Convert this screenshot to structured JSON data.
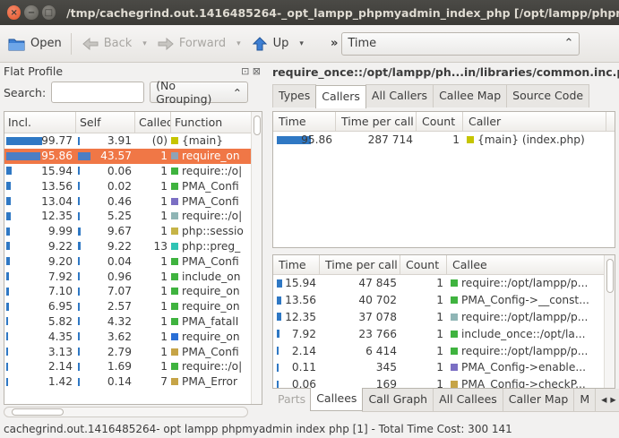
{
  "window": {
    "title": "/tmp/cachegrind.out.1416485264-_opt_lampp_phpmyadmin_index_php [/opt/lampp/phpmya",
    "close_glyph": "×",
    "min_glyph": "−",
    "max_glyph": "□"
  },
  "toolbar": {
    "open_label": "Open",
    "back_label": "Back",
    "forward_label": "Forward",
    "up_label": "Up",
    "overflow_label": "»",
    "event_type": "Time",
    "dropdown_glyph": "▾",
    "combo_glyph": "⌃"
  },
  "left": {
    "title": "Flat Profile",
    "header_icons": "⊡ ⊠",
    "search_label": "Search:",
    "search_value": "",
    "grouping_value": "(No Grouping)",
    "grouping_glyph": "⌃",
    "columns": [
      "Incl.",
      "Self",
      "Called",
      "Function"
    ],
    "rows": [
      {
        "incl": "99.77",
        "incl_pct": 99.77,
        "self": "3.91",
        "self_pct": 3.91,
        "called": "(0)",
        "func": "{main}",
        "color": "#c6c500",
        "selected": false
      },
      {
        "incl": "95.86",
        "incl_pct": 95.86,
        "self": "43.57",
        "self_pct": 43.57,
        "called": "1",
        "func": "require_on",
        "color": "#8fa3b5",
        "selected": true
      },
      {
        "incl": "15.94",
        "incl_pct": 15.94,
        "self": "0.06",
        "self_pct": 0.06,
        "called": "1",
        "func": "require::/o|",
        "color": "#3fb33f",
        "selected": false
      },
      {
        "incl": "13.56",
        "incl_pct": 13.56,
        "self": "0.02",
        "self_pct": 0.02,
        "called": "1",
        "func": "PMA_Confi",
        "color": "#3fb33f",
        "selected": false
      },
      {
        "incl": "13.04",
        "incl_pct": 13.04,
        "self": "0.46",
        "self_pct": 0.46,
        "called": "1",
        "func": "PMA_Confi",
        "color": "#7b6fc4",
        "selected": false
      },
      {
        "incl": "12.35",
        "incl_pct": 12.35,
        "self": "5.25",
        "self_pct": 5.25,
        "called": "1",
        "func": "require::/o|",
        "color": "#8fb5b5",
        "selected": false
      },
      {
        "incl": "9.99",
        "incl_pct": 9.99,
        "self": "9.67",
        "self_pct": 9.67,
        "called": "1",
        "func": "php::sessio",
        "color": "#c6b447",
        "selected": false
      },
      {
        "incl": "9.22",
        "incl_pct": 9.22,
        "self": "9.22",
        "self_pct": 9.22,
        "called": "13",
        "func": "php::preg_",
        "color": "#2fc4b4",
        "selected": false
      },
      {
        "incl": "9.20",
        "incl_pct": 9.2,
        "self": "0.04",
        "self_pct": 0.04,
        "called": "1",
        "func": "PMA_Confi",
        "color": "#3fb33f",
        "selected": false
      },
      {
        "incl": "7.92",
        "incl_pct": 7.92,
        "self": "0.96",
        "self_pct": 0.96,
        "called": "1",
        "func": "include_on",
        "color": "#3fb33f",
        "selected": false
      },
      {
        "incl": "7.10",
        "incl_pct": 7.1,
        "self": "7.07",
        "self_pct": 7.07,
        "called": "1",
        "func": "require_on",
        "color": "#3fb33f",
        "selected": false
      },
      {
        "incl": "6.95",
        "incl_pct": 6.95,
        "self": "2.57",
        "self_pct": 2.57,
        "called": "1",
        "func": "require_on",
        "color": "#3fb33f",
        "selected": false
      },
      {
        "incl": "5.82",
        "incl_pct": 5.82,
        "self": "4.32",
        "self_pct": 4.32,
        "called": "1",
        "func": "PMA_fatalI",
        "color": "#3fb33f",
        "selected": false
      },
      {
        "incl": "4.35",
        "incl_pct": 4.35,
        "self": "3.62",
        "self_pct": 3.62,
        "called": "1",
        "func": "require_on",
        "color": "#2a6fd6",
        "selected": false
      },
      {
        "incl": "3.13",
        "incl_pct": 3.13,
        "self": "2.79",
        "self_pct": 2.79,
        "called": "1",
        "func": "PMA_Confi",
        "color": "#c6a447",
        "selected": false
      },
      {
        "incl": "2.14",
        "incl_pct": 2.14,
        "self": "1.69",
        "self_pct": 1.69,
        "called": "1",
        "func": "require::/o|",
        "color": "#3fb33f",
        "selected": false
      },
      {
        "incl": "1.42",
        "incl_pct": 1.42,
        "self": "0.14",
        "self_pct": 0.14,
        "called": "7",
        "func": "PMA_Error",
        "color": "#c6a447",
        "selected": false
      }
    ]
  },
  "right": {
    "title": "require_once::/opt/lampp/ph...in/libraries/common.inc.php",
    "top_tabs": [
      {
        "label": "Types",
        "active": false,
        "disabled": false
      },
      {
        "label": "Callers",
        "active": true,
        "disabled": false
      },
      {
        "label": "All Callers",
        "active": false,
        "disabled": false
      },
      {
        "label": "Callee Map",
        "active": false,
        "disabled": false
      },
      {
        "label": "Source Code",
        "active": false,
        "disabled": false
      }
    ],
    "callers_columns": [
      "Time",
      "Time per call",
      "Count",
      "Caller"
    ],
    "callers_rows": [
      {
        "time": "95.86",
        "time_pct": 95.86,
        "per_call": "287 714",
        "count": "1",
        "name": "{main} (index.php)",
        "color": "#c6c500"
      }
    ],
    "callees_columns": [
      "Time",
      "Time per call",
      "Count",
      "Callee"
    ],
    "callees_rows": [
      {
        "time": "15.94",
        "time_pct": 15.94,
        "per_call": "47 845",
        "count": "1",
        "name": "require::/opt/lampp/p...",
        "color": "#3fb33f"
      },
      {
        "time": "13.56",
        "time_pct": 13.56,
        "per_call": "40 702",
        "count": "1",
        "name": "PMA_Config->__const...",
        "color": "#3fb33f"
      },
      {
        "time": "12.35",
        "time_pct": 12.35,
        "per_call": "37 078",
        "count": "1",
        "name": "require::/opt/lampp/p...",
        "color": "#8fb5b5"
      },
      {
        "time": "7.92",
        "time_pct": 7.92,
        "per_call": "23 766",
        "count": "1",
        "name": "include_once::/opt/la...",
        "color": "#3fb33f"
      },
      {
        "time": "2.14",
        "time_pct": 2.14,
        "per_call": "6 414",
        "count": "1",
        "name": "require::/opt/lampp/p...",
        "color": "#3fb33f"
      },
      {
        "time": "0.11",
        "time_pct": 0.11,
        "per_call": "345",
        "count": "1",
        "name": "PMA_Config->enable...",
        "color": "#7b6fc4"
      },
      {
        "time": "0.06",
        "time_pct": 0.06,
        "per_call": "169",
        "count": "1",
        "name": "PMA_Config->checkP...",
        "color": "#c6a447"
      }
    ],
    "bottom_tabs": [
      {
        "label": "Parts",
        "active": false,
        "disabled": true
      },
      {
        "label": "Callees",
        "active": true,
        "disabled": false
      },
      {
        "label": "Call Graph",
        "active": false,
        "disabled": false
      },
      {
        "label": "All Callees",
        "active": false,
        "disabled": false
      },
      {
        "label": "Caller Map",
        "active": false,
        "disabled": false
      },
      {
        "label": "M",
        "active": false,
        "disabled": false
      }
    ],
    "tab_scroll_glyph": "◂ ▸"
  },
  "status": {
    "text": "cachegrind.out.1416485264- opt lampp phpmyadmin index php [1] - Total Time Cost: 300 141"
  },
  "colors": {
    "bar": "#2f78c4",
    "selection": "#f07746"
  }
}
